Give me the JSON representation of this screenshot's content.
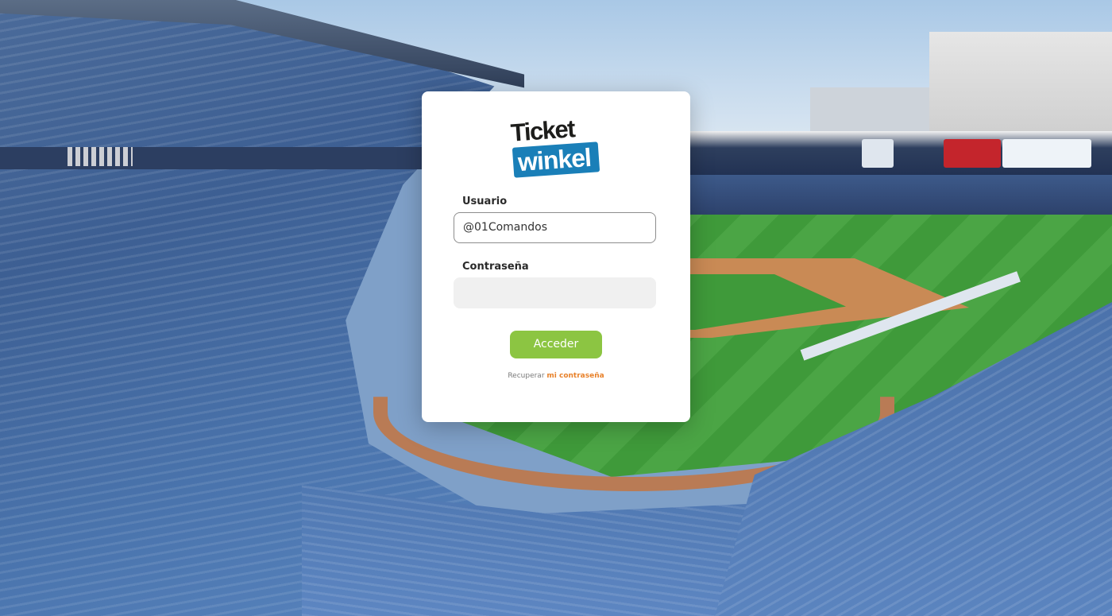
{
  "logo": {
    "line1": "Ticket",
    "line2": "winkel"
  },
  "login": {
    "user_label": "Usuario",
    "user_value": "@01Comandos",
    "password_label": "Contraseña",
    "password_value": "",
    "submit_label": "Acceder",
    "recover_prefix": "Recuperar",
    "recover_link": "mi contraseña"
  },
  "colors": {
    "submit": "#8cc542",
    "recover_link": "#e8812a",
    "logo_blue": "#1a7fb8"
  }
}
